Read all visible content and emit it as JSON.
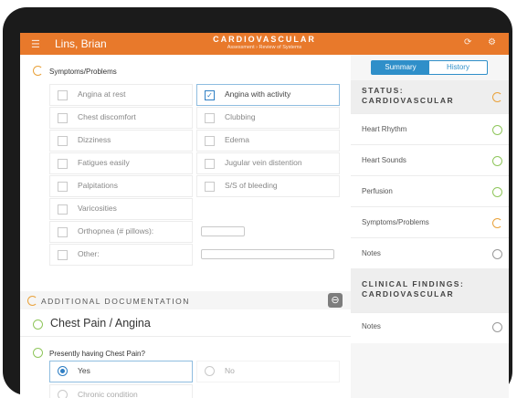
{
  "header": {
    "patient_name": "Lins, Brian",
    "title": "CARDIOVASCULAR",
    "subtitle": "Assessment › Review of Systems",
    "menu_icon": "hamburger-menu-icon",
    "right_icons": [
      "refresh-icon",
      "settings-icon"
    ],
    "accent_color": "#e8792b"
  },
  "symptoms": {
    "title": "Symptoms/Problems",
    "status_icon": "orange-partial-circle-icon",
    "items": [
      {
        "label": "Angina at rest",
        "checked": false
      },
      {
        "label": "Angina with activity",
        "checked": true
      },
      {
        "label": "Chest discomfort",
        "checked": false
      },
      {
        "label": "Clubbing",
        "checked": false
      },
      {
        "label": "Dizziness",
        "checked": false
      },
      {
        "label": "Edema",
        "checked": false
      },
      {
        "label": "Fatigues easily",
        "checked": false
      },
      {
        "label": "Jugular vein distention",
        "checked": false
      },
      {
        "label": "Palpitations",
        "checked": false
      },
      {
        "label": "S/S of bleeding",
        "checked": false
      },
      {
        "label": "Varicosities",
        "checked": false
      },
      {
        "label": "Orthopnea (# pillows):",
        "checked": false
      },
      {
        "label": "Other:",
        "checked": false
      }
    ]
  },
  "additional_documentation": {
    "title": "ADDITIONAL DOCUMENTATION",
    "collapse_icon": "minus-circle-icon"
  },
  "chest_pain": {
    "title": "Chest Pain / Angina",
    "question": "Presently having Chest Pain?",
    "options": [
      {
        "label": "Yes",
        "selected": true
      },
      {
        "label": "No",
        "selected": false
      },
      {
        "label": "Chronic condition",
        "selected": false
      }
    ]
  },
  "sidebar": {
    "tabs": [
      {
        "label": "Summary",
        "active": true
      },
      {
        "label": "History",
        "active": false
      }
    ],
    "status_title": "STATUS: CARDIOVASCULAR",
    "status_lines": [
      "STATUS:",
      "CARDIOVASCULAR"
    ],
    "status_items": [
      {
        "label": "Heart Rhythm",
        "state": "complete"
      },
      {
        "label": "Heart Sounds",
        "state": "complete"
      },
      {
        "label": "Perfusion",
        "state": "complete"
      },
      {
        "label": "Symptoms/Problems",
        "state": "in-progress"
      },
      {
        "label": "Notes",
        "state": "empty"
      }
    ],
    "clinical_title_lines": [
      "CLINICAL FINDINGS:",
      "CARDIOVASCULAR"
    ],
    "clinical_items": [
      {
        "label": "Notes",
        "state": "empty"
      }
    ]
  }
}
